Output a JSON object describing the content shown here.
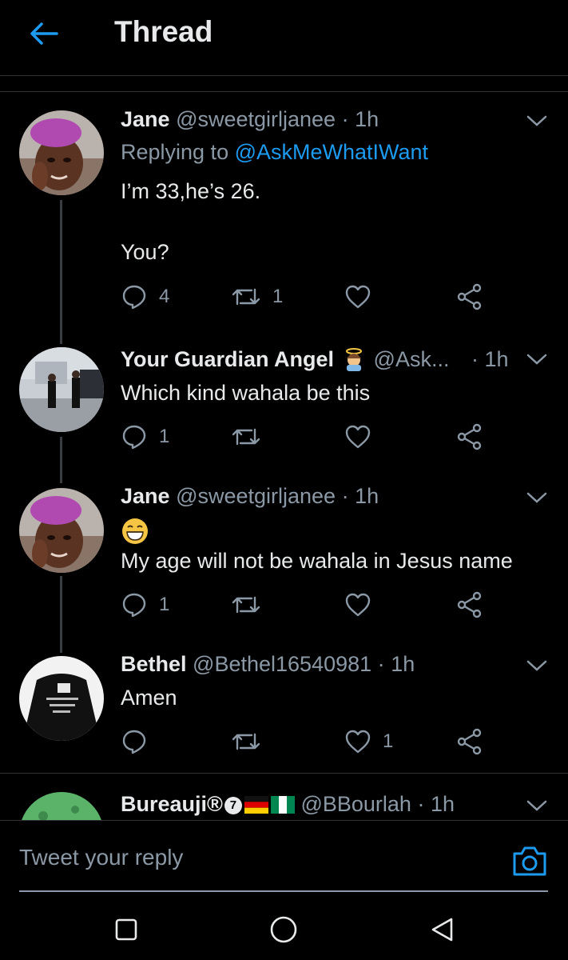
{
  "header": {
    "title": "Thread"
  },
  "tweets": [
    {
      "name": "Jane",
      "handle": "@sweetgirljanee",
      "time": "1h",
      "replying_prefix": "Replying to ",
      "replying_to": "@AskMeWhatIWant",
      "body": "I’m 33,he’s 26.\n\nYou?",
      "replies": "4",
      "retweets": "1",
      "likes": ""
    },
    {
      "name": "Your Guardian Angel",
      "handle": "@Ask...",
      "time": "1h",
      "body": "Which kind wahala be this",
      "replies": "1",
      "retweets": "",
      "likes": ""
    },
    {
      "name": "Jane",
      "handle": "@sweetgirljanee",
      "time": "1h",
      "body": "My age will not be wahala in Jesus name",
      "replies": "1",
      "retweets": "",
      "likes": ""
    },
    {
      "name": "Bethel",
      "handle": "@Bethel16540981",
      "time": "1h",
      "body": "Amen",
      "replies": "",
      "retweets": "",
      "likes": "1"
    },
    {
      "name": "Bureauji®",
      "badge": "7",
      "handle": "@BBourlah",
      "time": "1h"
    }
  ],
  "composer": {
    "placeholder": "Tweet your reply"
  },
  "colors": {
    "accent": "#1d9bf0",
    "muted": "#8b98a5",
    "background": "#000000"
  }
}
